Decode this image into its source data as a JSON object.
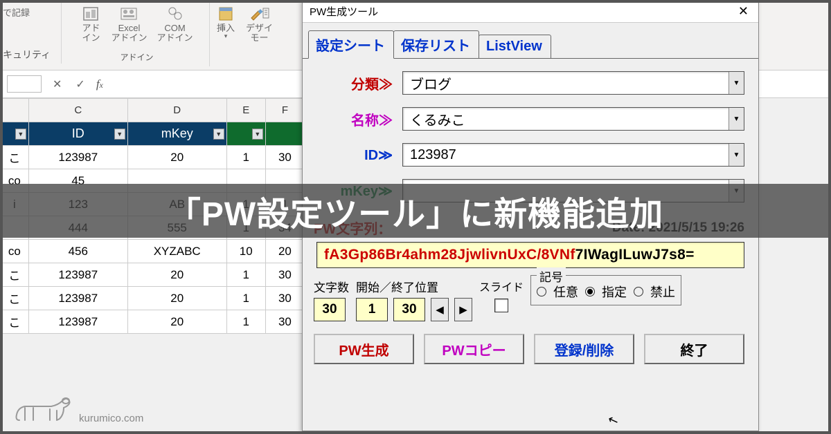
{
  "ribbon": {
    "security_partial": "キュリティ",
    "record_partial": "で記録",
    "addins": {
      "addin": "アド\nイン",
      "excel_addin": "Excel\nアドイン",
      "com_addin": "COM\nアドイン",
      "group_label": "アドイン"
    },
    "insert": "挿入",
    "design_mode": "デザイ\nモー"
  },
  "sheet": {
    "col_headers": [
      "C",
      "D",
      "E",
      "F"
    ],
    "header_row": {
      "c": "ID",
      "d": "mKey",
      "e": "",
      "f": ""
    },
    "rows": [
      {
        "b": "こ",
        "c": "123987",
        "d": "20",
        "e": "1",
        "f": "30"
      },
      {
        "b": "co",
        "c": "45",
        "d": "",
        "e": "",
        "f": ""
      },
      {
        "b": "i",
        "c": "123",
        "d": "AB",
        "e": "1",
        "f": "1"
      },
      {
        "b": "",
        "c": "444",
        "d": "555",
        "e": "1",
        "f": "34"
      },
      {
        "b": "co",
        "c": "456",
        "d": "XYZABC",
        "e": "10",
        "f": "20"
      },
      {
        "b": "こ",
        "c": "123987",
        "d": "20",
        "e": "1",
        "f": "30"
      },
      {
        "b": "こ",
        "c": "123987",
        "d": "20",
        "e": "1",
        "f": "30"
      },
      {
        "b": "こ",
        "c": "123987",
        "d": "20",
        "e": "1",
        "f": "30"
      }
    ]
  },
  "dialog": {
    "title": "PW生成ツール",
    "tabs": [
      "設定シート",
      "保存リスト",
      "ListView"
    ],
    "fields": {
      "category_label": "分類≫",
      "category_value": "ブログ",
      "name_label": "名称≫",
      "name_value": "くるみこ",
      "id_label": "ID≫",
      "id_value": "123987",
      "mkey_label": "mKey≫",
      "mkey_value": ""
    },
    "pwstr_label": "PW文字列：",
    "date_label": "Date: 2021/5/15 19:26",
    "pw_output_main": "fA3Gp86Br4ahm28JjwlivnUxC/8VNf",
    "pw_output_tail": "7IWagILuwJ7s8=",
    "len_label": "文字数",
    "pos_label": "開始／終了位置",
    "slide_label": "スライド",
    "len_value": "30",
    "start_value": "1",
    "end_value": "30",
    "kigou_legend": "記号",
    "radio_any": "任意",
    "radio_spec": "指定",
    "radio_forbid": "禁止",
    "buttons": {
      "gen": "PW生成",
      "copy": "PWコピー",
      "reg": "登録/削除",
      "exit": "終了"
    }
  },
  "banner": "「PW設定ツール」に新機能追加",
  "watermark": "kurumico.com"
}
